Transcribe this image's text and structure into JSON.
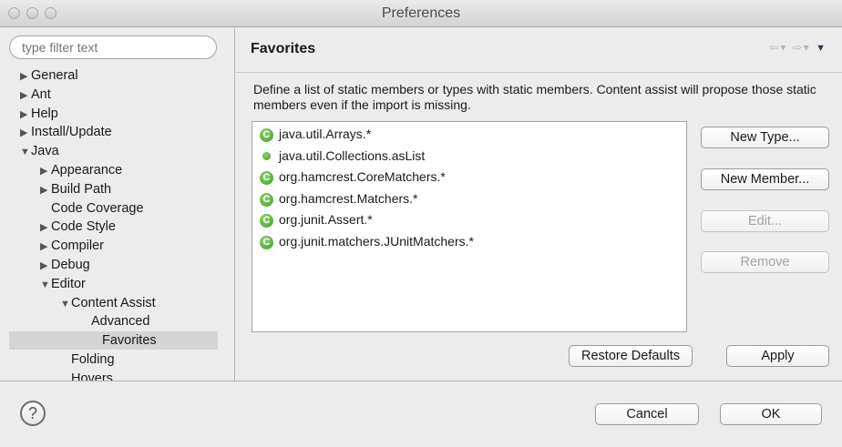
{
  "window": {
    "title": "Preferences"
  },
  "sidebar": {
    "filter_placeholder": "type filter text",
    "items": [
      {
        "label": "General",
        "level": 0,
        "twisty": "▶"
      },
      {
        "label": "Ant",
        "level": 0,
        "twisty": "▶"
      },
      {
        "label": "Help",
        "level": 0,
        "twisty": "▶"
      },
      {
        "label": "Install/Update",
        "level": 0,
        "twisty": "▶"
      },
      {
        "label": "Java",
        "level": 0,
        "twisty": "▼"
      },
      {
        "label": "Appearance",
        "level": 1,
        "twisty": "▶"
      },
      {
        "label": "Build Path",
        "level": 1,
        "twisty": "▶"
      },
      {
        "label": "Code Coverage",
        "level": 1,
        "twisty": ""
      },
      {
        "label": "Code Style",
        "level": 1,
        "twisty": "▶"
      },
      {
        "label": "Compiler",
        "level": 1,
        "twisty": "▶"
      },
      {
        "label": "Debug",
        "level": 1,
        "twisty": "▶"
      },
      {
        "label": "Editor",
        "level": 1,
        "twisty": "▼"
      },
      {
        "label": "Content Assist",
        "level": 2,
        "twisty": "▼"
      },
      {
        "label": "Advanced",
        "level": 3,
        "twisty": ""
      },
      {
        "label": "Favorites",
        "level": 3,
        "twisty": "",
        "selected": true
      },
      {
        "label": "Folding",
        "level": 2,
        "twisty": ""
      },
      {
        "label": "Hovers",
        "level": 2,
        "twisty": ""
      }
    ]
  },
  "main": {
    "title": "Favorites",
    "description": "Define a list of static members or types with static members. Content assist will propose those static members even if the import is missing.",
    "favorites": [
      {
        "label": "java.util.Arrays.*",
        "kind": "type"
      },
      {
        "label": "java.util.Collections.asList",
        "kind": "member"
      },
      {
        "label": "org.hamcrest.CoreMatchers.*",
        "kind": "type"
      },
      {
        "label": "org.hamcrest.Matchers.*",
        "kind": "type"
      },
      {
        "label": "org.junit.Assert.*",
        "kind": "type"
      },
      {
        "label": "org.junit.matchers.JUnitMatchers.*",
        "kind": "type"
      }
    ],
    "buttons": {
      "new_type": "New Type...",
      "new_member": "New Member...",
      "edit": "Edit...",
      "remove": "Remove",
      "restore_defaults": "Restore Defaults",
      "apply": "Apply"
    }
  },
  "footer": {
    "help": "?",
    "cancel": "Cancel",
    "ok": "OK"
  },
  "icons": {
    "type_icon_glyph": "C"
  }
}
